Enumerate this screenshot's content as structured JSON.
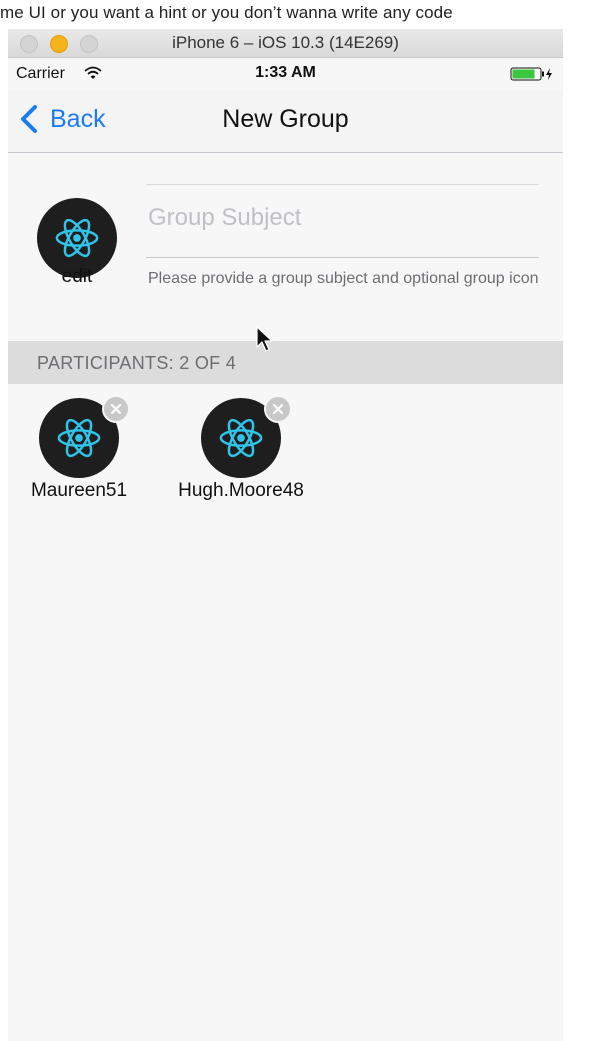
{
  "page": {
    "caption": "me UI or you want a hint or you don’t wanna write any code"
  },
  "simulator": {
    "title": "iPhone 6 – iOS 10.3 (14E269)",
    "traffic_lights": [
      "close",
      "minimize",
      "maximize"
    ]
  },
  "status_bar": {
    "carrier": "Carrier",
    "time": "1:33 AM",
    "icons": [
      "wifi-icon",
      "battery-icon"
    ]
  },
  "nav_bar": {
    "back_label": "Back",
    "back_icon": "chevron-left-icon",
    "title": "New Group"
  },
  "group": {
    "icon_name": "react-logo-icon",
    "edit_label": "edit",
    "subject_value": "",
    "subject_placeholder": "Group Subject",
    "hint": "Please provide a group subject and optional group icon"
  },
  "participants": {
    "header": "PARTICIPANTS: 2 OF 4",
    "items": [
      {
        "name": "Maureen51",
        "avatar_icon": "react-logo-icon",
        "remove_icon": "remove-x-icon"
      },
      {
        "name": "Hugh.Moore48",
        "avatar_icon": "react-logo-icon",
        "remove_icon": "remove-x-icon"
      }
    ]
  },
  "colors": {
    "accent": "#1a7cf5",
    "react_logo": "#2fc4e8",
    "avatar_bg": "#1e1e1e",
    "section_header_bg": "#dcdcdc"
  }
}
